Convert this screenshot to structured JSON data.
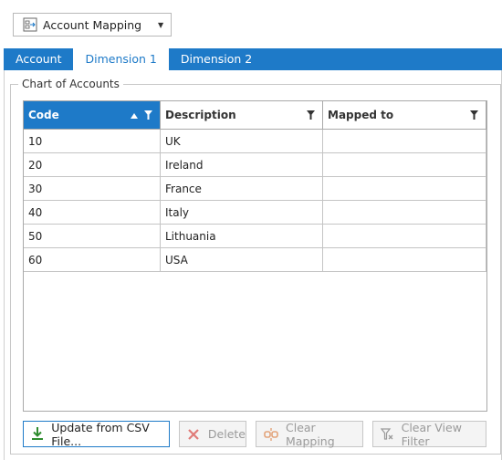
{
  "mode_dropdown": {
    "value": "Account Mapping",
    "icon": "mapping-icon"
  },
  "tabs": [
    {
      "label": "Account",
      "active": false
    },
    {
      "label": "Dimension 1",
      "active": true
    },
    {
      "label": "Dimension 2",
      "active": false
    }
  ],
  "group": {
    "title": "Chart of Accounts"
  },
  "grid": {
    "columns": [
      {
        "label": "Code",
        "sort": "ascending",
        "filter": true
      },
      {
        "label": "Description",
        "filter": true
      },
      {
        "label": "Mapped to",
        "filter": true
      }
    ],
    "rows": [
      {
        "code": "10",
        "description": "UK",
        "mapped_to": ""
      },
      {
        "code": "20",
        "description": "Ireland",
        "mapped_to": ""
      },
      {
        "code": "30",
        "description": "France",
        "mapped_to": ""
      },
      {
        "code": "40",
        "description": "Italy",
        "mapped_to": ""
      },
      {
        "code": "50",
        "description": "Lithuania",
        "mapped_to": ""
      },
      {
        "code": "60",
        "description": "USA",
        "mapped_to": ""
      }
    ]
  },
  "buttons": {
    "update": {
      "label": "Update from CSV File...",
      "enabled": true
    },
    "delete": {
      "label": "Delete",
      "enabled": false
    },
    "clear_mapping": {
      "label": "Clear Mapping",
      "enabled": false
    },
    "clear_view_filter": {
      "label": "Clear View Filter",
      "enabled": false
    }
  },
  "colors": {
    "accent": "#1e7ac8",
    "import_icon": "#2e8b2e",
    "delete_icon": "#d9534f",
    "disabled_text": "#9a9a9a"
  }
}
